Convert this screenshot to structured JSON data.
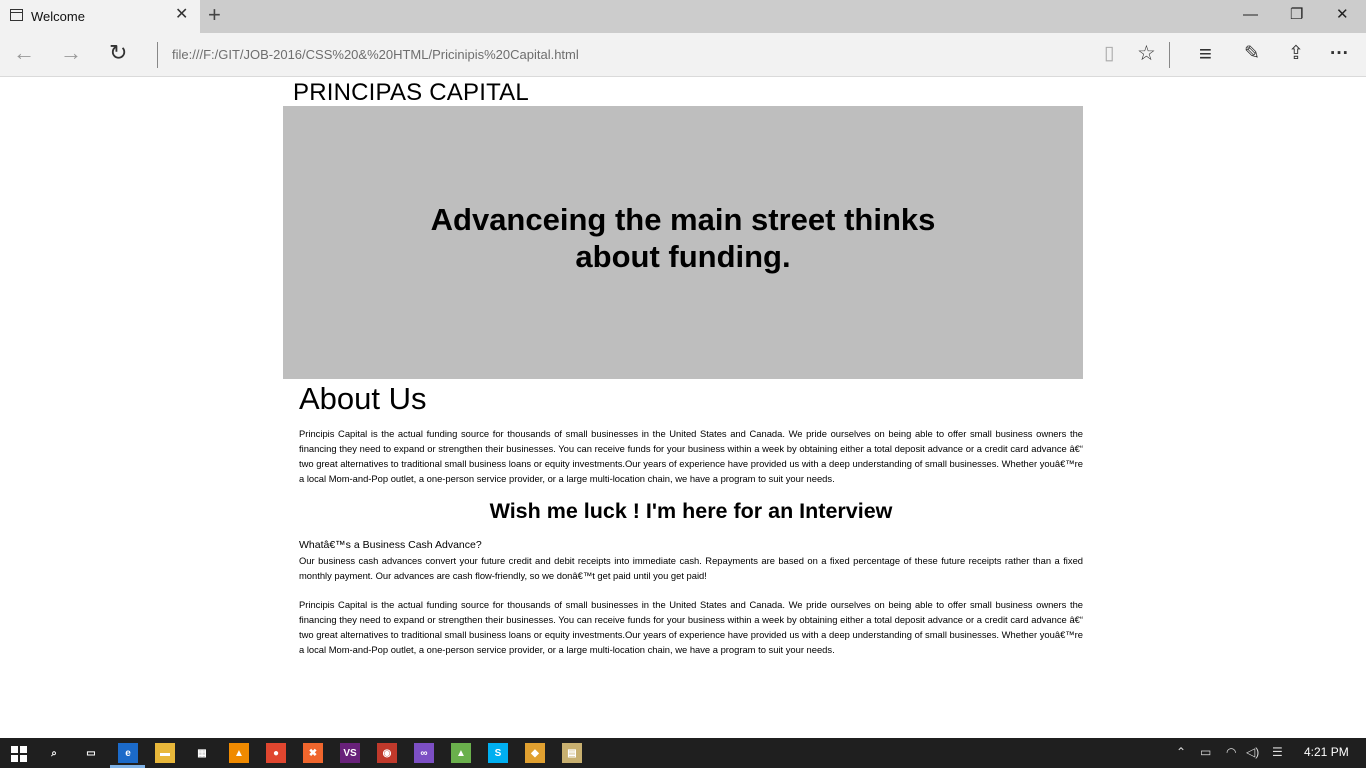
{
  "browser": {
    "tab_title": "Welcome",
    "tab_close": "✕",
    "new_tab": "+",
    "address": "file:///F:/GIT/JOB-2016/CSS%20&%20HTML/Pricinipis%20Capital.html",
    "back": "←",
    "forward": "→",
    "refresh": "↻",
    "minimize": "—",
    "restore": "❐",
    "close": "✕",
    "reading_view": "▯",
    "favorite": "☆",
    "hub": "≡",
    "notes": "✎",
    "share": "⇪",
    "more": "···"
  },
  "page": {
    "brand": "PRINCIPAS CAPITAL",
    "hero_title": "Advanceing the main street thinks about funding.",
    "about_title": "About Us",
    "about_text": "Principis Capital is the actual funding source for thousands of small businesses in the United States and Canada. We pride ourselves on being able to offer small business owners the financing they need to expand or strengthen their businesses. You can receive funds for your business within a week by obtaining either a total deposit advance or a credit card advance â€“ two great alternatives to traditional small business loans or equity investments.Our years of experience have provided us with a deep understanding of small businesses. Whether youâ€™re a local Mom-and-Pop outlet, a one-person service provider, or a large multi-location chain, we have a program to suit your needs.",
    "interview_title": "Wish me luck ! I'm here for an Interview",
    "cash_advance_title": "Whatâ€™s a Business Cash Advance?",
    "cash_advance_text": "Our business cash advances convert your future credit and debit receipts into immediate cash. Repayments are based on a fixed percentage of these future receipts rather than a fixed monthly payment. Our advances are cash flow-friendly, so we donâ€™t get paid until you get paid!",
    "about_text_repeat": "Principis Capital is the actual funding source for thousands of small businesses in the United States and Canada. We pride ourselves on being able to offer small business owners the financing they need to expand or strengthen their businesses. You can receive funds for your business within a week by obtaining either a total deposit advance or a credit card advance â€“ two great alternatives to traditional small business loans or equity investments.Our years of experience have provided us with a deep understanding of small businesses. Whether youâ€™re a local Mom-and-Pop outlet, a one-person service provider, or a large multi-location chain, we have a program to suit your needs."
  },
  "taskbar": {
    "clock": "4:21 PM",
    "apps": [
      {
        "name": "search-icon",
        "glyph": "⌕",
        "color": "#1f1f1f"
      },
      {
        "name": "task-view-icon",
        "glyph": "▭",
        "color": "#1f1f1f"
      },
      {
        "name": "edge-icon",
        "glyph": "e",
        "color": "#1b6ac9"
      },
      {
        "name": "file-explorer-icon",
        "glyph": "▬",
        "color": "#e8b73a"
      },
      {
        "name": "store-icon",
        "glyph": "▦",
        "color": "#1f1f1f"
      },
      {
        "name": "vlc-icon",
        "glyph": "▲",
        "color": "#f08a00"
      },
      {
        "name": "chrome-icon",
        "glyph": "●",
        "color": "#e0462f"
      },
      {
        "name": "xampp-icon",
        "glyph": "✖",
        "color": "#f0662d"
      },
      {
        "name": "vs-icon",
        "glyph": "VS",
        "color": "#68217a"
      },
      {
        "name": "app-red-icon",
        "glyph": "◉",
        "color": "#c0392b"
      },
      {
        "name": "visual-studio-icon",
        "glyph": "∞",
        "color": "#7c4fc4"
      },
      {
        "name": "android-icon",
        "glyph": "▲",
        "color": "#6ab04c"
      },
      {
        "name": "skype-icon",
        "glyph": "S",
        "color": "#00aff0"
      },
      {
        "name": "sourcetree-icon",
        "glyph": "◆",
        "color": "#e0a030"
      },
      {
        "name": "notepad-icon",
        "glyph": "▤",
        "color": "#c8b070"
      }
    ],
    "tray_up": "⌃",
    "tray_battery": "▭",
    "tray_wifi": "◠",
    "tray_volume": "◁)",
    "tray_notifications": "☰"
  }
}
